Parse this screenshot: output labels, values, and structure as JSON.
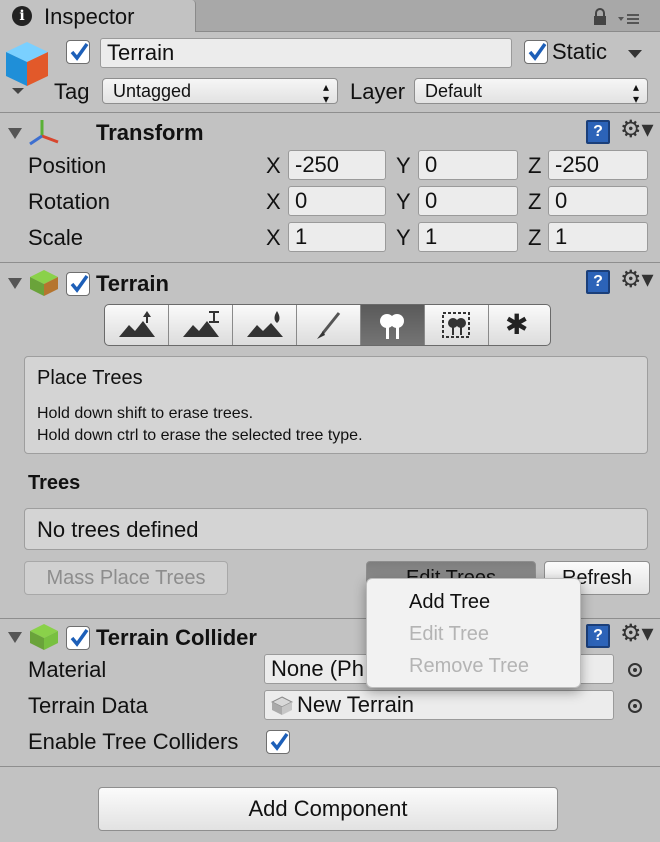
{
  "window": {
    "tab_title": "Inspector"
  },
  "object": {
    "name": "Terrain",
    "static_label": "Static",
    "tag_label": "Tag",
    "tag_value": "Untagged",
    "layer_label": "Layer",
    "layer_value": "Default"
  },
  "transform": {
    "title": "Transform",
    "rows": [
      {
        "label": "Position",
        "x": "-250",
        "y": "0",
        "z": "-250"
      },
      {
        "label": "Rotation",
        "x": "0",
        "y": "0",
        "z": "0"
      },
      {
        "label": "Scale",
        "x": "1",
        "y": "1",
        "z": "1"
      }
    ],
    "axis": {
      "x": "X",
      "y": "Y",
      "z": "Z"
    }
  },
  "terrain": {
    "title": "Terrain",
    "tools": [
      "raise-lower-terrain-icon",
      "paint-height-icon",
      "smooth-height-icon",
      "paint-texture-icon",
      "place-trees-icon",
      "paint-details-icon",
      "terrain-settings-icon"
    ],
    "active_tool_index": 4,
    "help_title": "Place Trees",
    "help_line1": "Hold down shift to erase trees.",
    "help_line2": "Hold down ctrl to erase the selected tree type.",
    "trees_header": "Trees",
    "trees_empty": "No trees defined",
    "mass_place_label": "Mass Place Trees",
    "edit_trees_label": "Edit Trees",
    "refresh_label": "Refresh"
  },
  "edit_trees_menu": {
    "items": [
      {
        "label": "Add Tree",
        "enabled": true
      },
      {
        "label": "Edit Tree",
        "enabled": false
      },
      {
        "label": "Remove Tree",
        "enabled": false
      }
    ]
  },
  "collider": {
    "title": "Terrain Collider",
    "material_label": "Material",
    "material_value": "None (Ph",
    "terrain_data_label": "Terrain Data",
    "terrain_data_value": "New Terrain",
    "enable_tree_colliders_label": "Enable Tree Colliders"
  },
  "footer": {
    "add_component_label": "Add Component"
  },
  "colors": {
    "panel_bg": "#c2c2c2",
    "help_icon": "#2c63b8",
    "menu_bg": "#f2f2f2"
  }
}
